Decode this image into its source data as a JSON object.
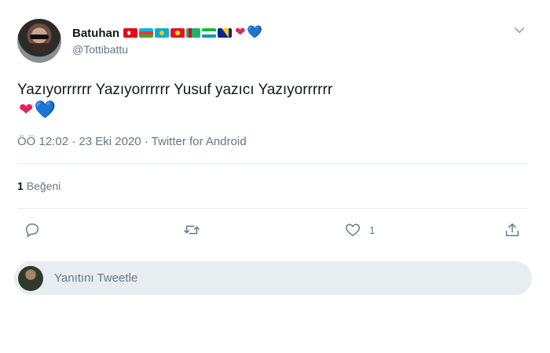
{
  "tweet": {
    "author": {
      "display_name": "Batuhan",
      "handle": "@Tottibattu",
      "name_flags": [
        "turkey-flag",
        "azerbaijan-flag",
        "kazakhstan-flag",
        "kyrgyzstan-flag",
        "turkmenistan-flag",
        "uzbekistan-flag",
        "bosnia-flag"
      ],
      "name_hearts": [
        "❤",
        "💙"
      ]
    },
    "text": "Yazıyorrrrrr Yazıyorrrrrr Yusuf yazıcı Yazıyorrrrrr",
    "text_hearts": [
      "❤",
      "💙"
    ],
    "meta": "ÖÖ 12:02 · 23 Eki 2020 · Twitter for Android",
    "likes": {
      "count": "1",
      "label": "Beğeni"
    },
    "actions": {
      "reply_icon": "reply-icon",
      "retweet_icon": "retweet-icon",
      "like_icon": "like-icon",
      "like_count": "1",
      "share_icon": "share-icon"
    },
    "reply_box": {
      "placeholder": "Yanıtını Tweetle"
    },
    "colors": {
      "text": "#14171a",
      "secondary": "#657786",
      "divider": "#e6ecf0",
      "reply_box_bg": "#e8edf0",
      "heart_red": "#e0245e",
      "heart_blue": "#5daee8"
    }
  }
}
